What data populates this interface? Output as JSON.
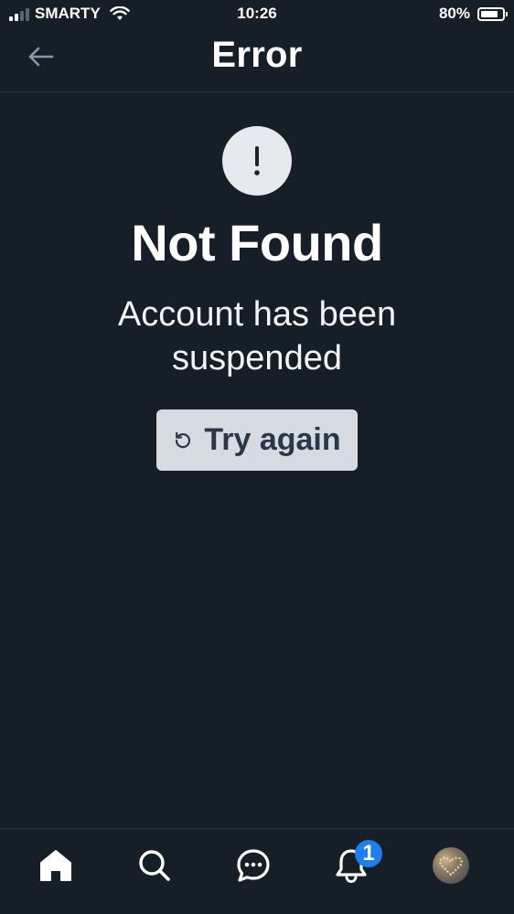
{
  "status_bar": {
    "carrier": "SMARTY",
    "time": "10:26",
    "battery_percent": "80%",
    "battery_level": 0.8,
    "signal_bars_active": 2,
    "signal_bars_total": 4
  },
  "header": {
    "title": "Error",
    "back_icon": "arrow-left-icon"
  },
  "error": {
    "icon": "exclamation-icon",
    "title": "Not Found",
    "message": "Account has been suspended",
    "retry_label": "Try again",
    "retry_icon": "refresh-icon"
  },
  "tab_bar": {
    "items": [
      {
        "name": "home",
        "icon": "home-icon",
        "active": true
      },
      {
        "name": "search",
        "icon": "search-icon",
        "active": false
      },
      {
        "name": "messages",
        "icon": "chat-bubble-icon",
        "active": false
      },
      {
        "name": "notifications",
        "icon": "bell-icon",
        "active": false
      },
      {
        "name": "profile",
        "icon": "avatar",
        "active": false
      }
    ],
    "notification_count": "1"
  },
  "colors": {
    "background": "#161e27",
    "divider": "#2c3640",
    "button_bg": "#d6dbe2",
    "button_text": "#2a3746",
    "badge": "#1d7ff0",
    "icon_muted": "#8b98a5"
  }
}
